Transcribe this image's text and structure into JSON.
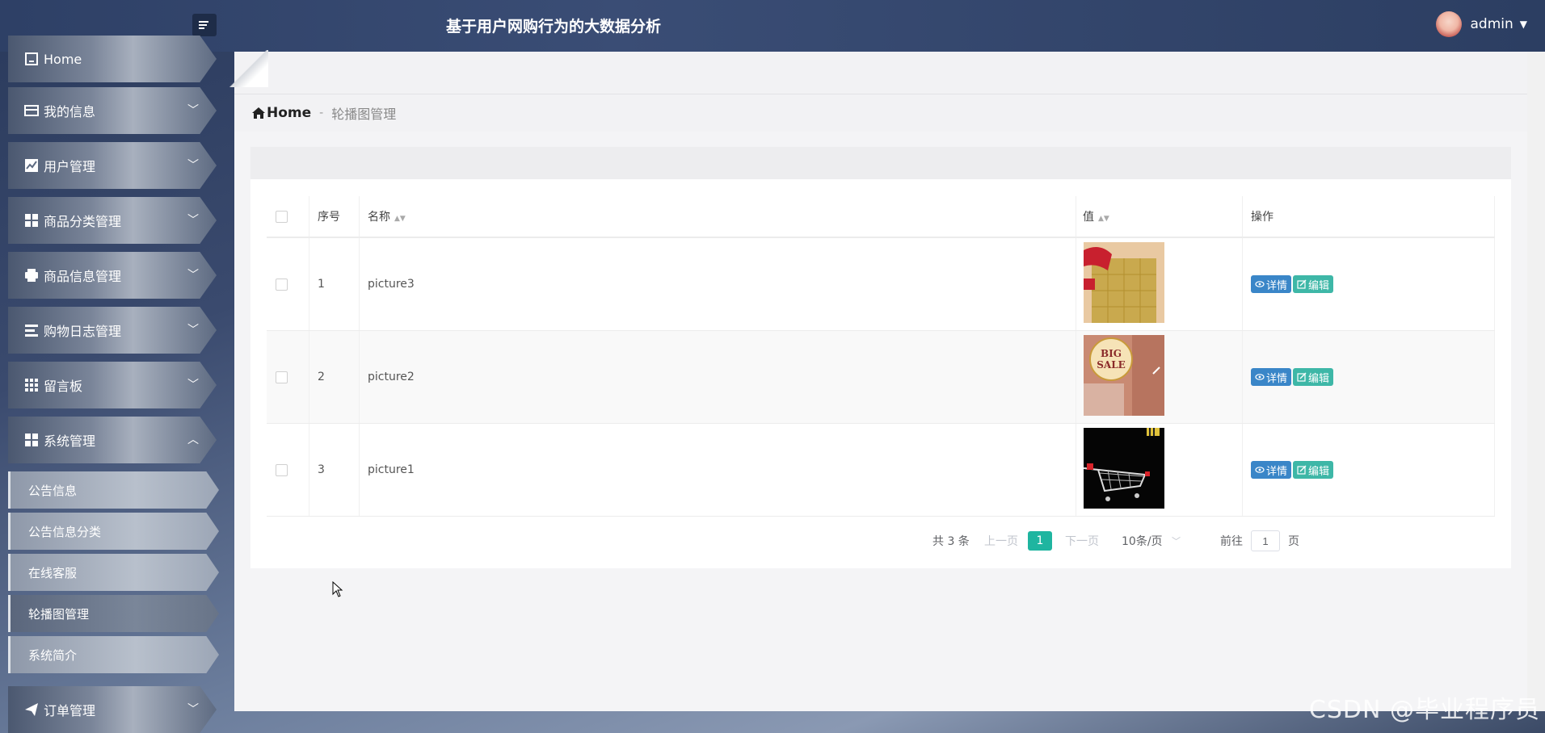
{
  "header": {
    "title": "基于用户网购行为的大数据分析",
    "user": "admin"
  },
  "sidebar": {
    "items": [
      {
        "label": "Home",
        "icon": "home-icon"
      },
      {
        "label": "我的信息",
        "icon": "card-icon"
      },
      {
        "label": "用户管理",
        "icon": "chart-icon"
      },
      {
        "label": "商品分类管理",
        "icon": "grid-icon"
      },
      {
        "label": "商品信息管理",
        "icon": "printer-icon"
      },
      {
        "label": "购物日志管理",
        "icon": "list-icon"
      },
      {
        "label": "留言板",
        "icon": "apps-icon"
      },
      {
        "label": "系统管理",
        "icon": "grid-icon"
      },
      {
        "label": "订单管理",
        "icon": "send-icon"
      }
    ],
    "sub_items": [
      "公告信息",
      "公告信息分类",
      "在线客服",
      "轮播图管理",
      "系统简介"
    ]
  },
  "breadcrumb": {
    "home": "Home",
    "separator": "-",
    "current": "轮播图管理"
  },
  "table": {
    "columns": [
      "序号",
      "名称",
      "值",
      "操作"
    ],
    "rows": [
      {
        "index": "1",
        "name": "picture3",
        "thumb": "red-gift-box-thumbnail"
      },
      {
        "index": "2",
        "name": "picture2",
        "thumb": "big-sale-thumbnail"
      },
      {
        "index": "3",
        "name": "picture1",
        "thumb": "shopping-cart-thumbnail"
      }
    ],
    "detail_label": "详情",
    "edit_label": "编辑"
  },
  "pagination": {
    "total": "共 3 条",
    "prev": "上一页",
    "current_page": "1",
    "next": "下一页",
    "page_size": "10条/页",
    "goto": "前往",
    "goto_value": "1",
    "unit": "页"
  },
  "watermark": "CSDN @毕业程序员",
  "colors": {
    "accent": "#1fb5a0",
    "detail_button": "#3a86c8",
    "edit_button": "#3eb7a7"
  }
}
